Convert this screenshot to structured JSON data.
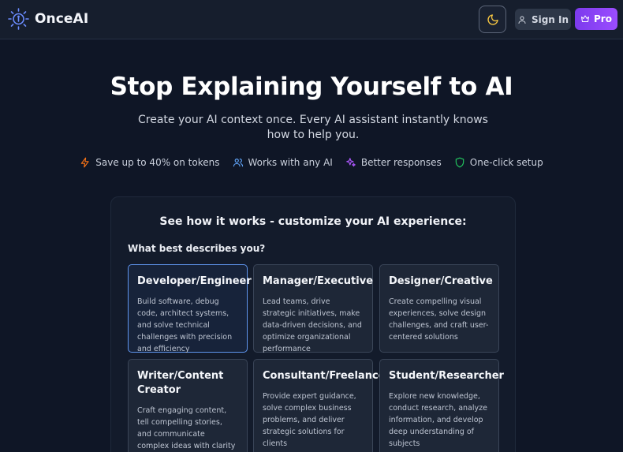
{
  "header": {
    "brand": "OnceAI",
    "signin_label": "Sign In",
    "pro_label": "Pro"
  },
  "hero": {
    "title": "Stop Explaining Yourself to AI",
    "subtitle": "Create your AI context once. Every AI assistant instantly knows how to help you.",
    "features": [
      {
        "label": "Save up to 40% on tokens",
        "icon": "lightning-icon",
        "color": "#f97316"
      },
      {
        "label": "Works with any AI",
        "icon": "users-icon",
        "color": "#60a5fa"
      },
      {
        "label": "Better responses",
        "icon": "sparkles-icon",
        "color": "#a855f7"
      },
      {
        "label": "One-click setup",
        "icon": "shield-icon",
        "color": "#22c55e"
      }
    ]
  },
  "panel": {
    "title": "See how it works - customize your AI experience:",
    "question": "What best describes you?",
    "cards": [
      {
        "title": "Developer/Engineer",
        "desc": "Build software, debug code, architect systems, and solve technical challenges with precision and efficiency",
        "selected": true
      },
      {
        "title": "Manager/Executive",
        "desc": "Lead teams, drive strategic initiatives, make data-driven decisions, and optimize organizational performance",
        "selected": false
      },
      {
        "title": "Designer/Creative",
        "desc": "Create compelling visual experiences, solve design challenges, and craft user-centered solutions",
        "selected": false
      },
      {
        "title": "Writer/Content Creator",
        "desc": "Craft engaging content, tell compelling stories, and communicate complex ideas with clarity and impact",
        "selected": false
      },
      {
        "title": "Consultant/Freelancer",
        "desc": "Provide expert guidance, solve complex business problems, and deliver strategic solutions for clients",
        "selected": false
      },
      {
        "title": "Student/Researcher",
        "desc": "Explore new knowledge, conduct research, analyze information, and develop deep understanding of subjects",
        "selected": false
      }
    ]
  },
  "colors": {
    "background": "#0f1626",
    "accent_purple": "#7c3aed",
    "selected_border": "#5f95ee"
  }
}
